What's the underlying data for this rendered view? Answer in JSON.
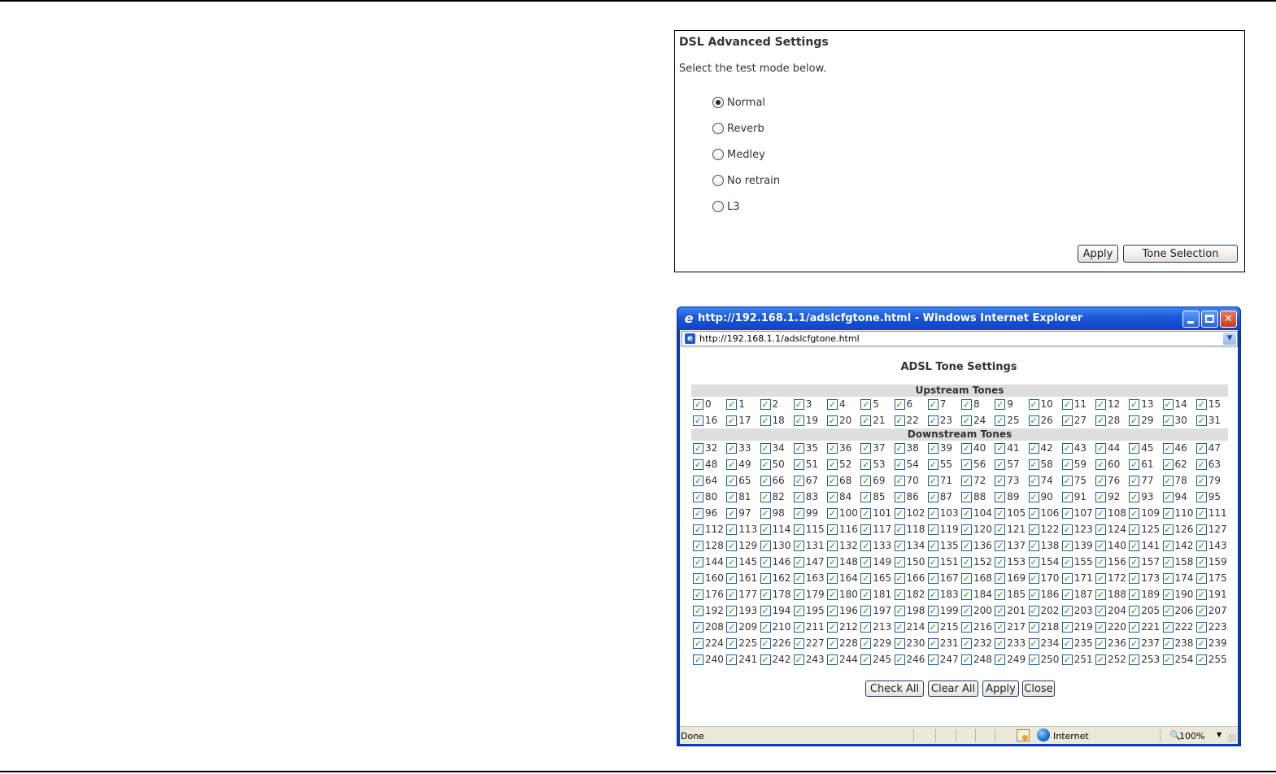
{
  "dsl_panel": {
    "title": "DSL Advanced Settings",
    "description": "Select the test mode below.",
    "modes": [
      {
        "label": "Normal",
        "checked": true
      },
      {
        "label": "Reverb",
        "checked": false
      },
      {
        "label": "Medley",
        "checked": false
      },
      {
        "label": "No retrain",
        "checked": false
      },
      {
        "label": "L3",
        "checked": false
      }
    ],
    "apply_label": "Apply",
    "tone_selection_label": "Tone Selection"
  },
  "ie_window": {
    "title": "http://192.168.1.1/adslcfgtone.html - Windows Internet Explorer",
    "address": "http://192.168.1.1/adslcfgtone.html",
    "page_title": "ADSL Tone Settings",
    "upstream_header": "Upstream Tones",
    "downstream_header": "Downstream Tones",
    "upstream_tone_range": [
      0,
      31
    ],
    "downstream_tone_range": [
      32,
      255
    ],
    "tones_per_row": 16,
    "all_tones_checked": true,
    "buttons": {
      "check_all": "Check All",
      "clear_all": "Clear All",
      "apply": "Apply",
      "close": "Close"
    },
    "status": {
      "text": "Done",
      "zone": "Internet",
      "zoom": "100%"
    },
    "icons": {
      "browser": "ie-logo-icon",
      "page": "page-icon",
      "security": "security-zone-icon",
      "zone": "globe-icon",
      "zoom": "magnifier-icon"
    }
  },
  "colors": {
    "titlebar": "#0c44c4",
    "checkmark": "#1a9a1a",
    "section_header_bg": "#dedede"
  }
}
